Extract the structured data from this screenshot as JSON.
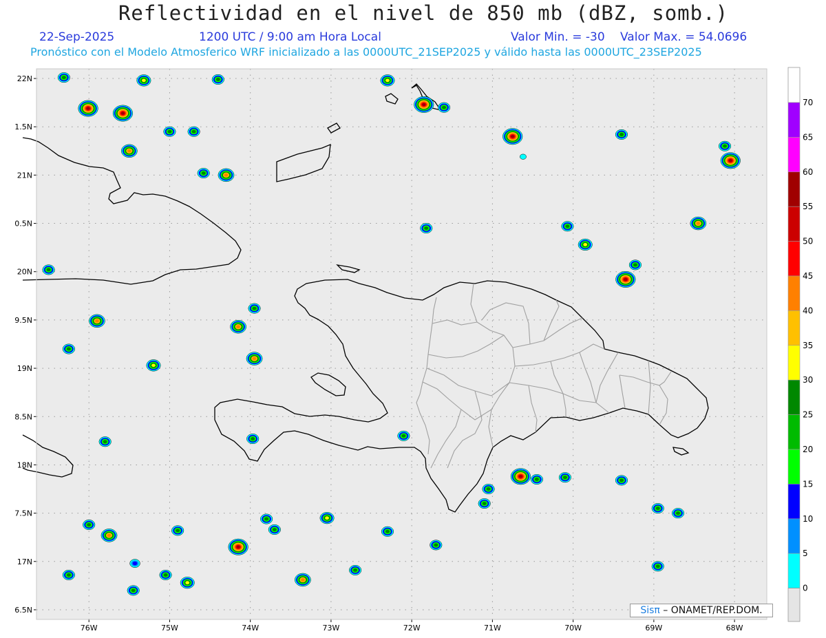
{
  "header": {
    "title": "Reflectividad en el nivel de 850 mb (dBZ, somb.)",
    "date": "22-Sep-2025",
    "time": "1200 UTC / 9:00 am Hora Local",
    "min_label": "Valor Min. = -30",
    "max_label": "Valor Max. = 54.0696",
    "forecast_line": "Pronóstico con el Modelo Atmosferico WRF inicializado a las 0000UTC_21SEP2025 y válido hasta las  0000UTC_23SEP2025"
  },
  "map": {
    "background_color": "#ebebeb",
    "lon_ticks": [
      "76W",
      "75W",
      "74W",
      "73W",
      "72W",
      "71W",
      "70W",
      "69W",
      "68W"
    ],
    "lat_ticks": [
      "22N",
      "1.5N",
      "21N",
      "0.5N",
      "20N",
      "9.5N",
      "19N",
      "8.5N",
      "18N",
      "7.5N",
      "17N",
      "6.5N"
    ]
  },
  "colorbar": {
    "labels": [
      "70",
      "65",
      "60",
      "55",
      "50",
      "45",
      "40",
      "35",
      "30",
      "25",
      "20",
      "15",
      "10",
      "5",
      "0"
    ],
    "colors": [
      "#a000ff",
      "#ff00ff",
      "#a00000",
      "#cc0000",
      "#ff0000",
      "#ff8000",
      "#ffc000",
      "#ffff00",
      "#008800",
      "#00bb00",
      "#00ff00",
      "#0000ff",
      "#0090ff",
      "#00ffff"
    ],
    "bottom_color": "#e5e5e5",
    "top_color": "#ffffff"
  },
  "credit": {
    "brand": "Sisπ",
    "org": " – ONAMET/REP.DOM."
  },
  "echoes": [
    {
      "lon": -76.01,
      "lat": 21.69,
      "peak": "red"
    },
    {
      "lon": -75.58,
      "lat": 21.64,
      "peak": "red"
    },
    {
      "lon": -75.5,
      "lat": 21.25,
      "peak": "orange"
    },
    {
      "lon": -75.32,
      "lat": 21.98,
      "peak": "yellow"
    },
    {
      "lon": -76.31,
      "lat": 22.01,
      "peak": "green"
    },
    {
      "lon": -75.0,
      "lat": 21.45,
      "peak": "green"
    },
    {
      "lon": -74.7,
      "lat": 21.45,
      "peak": "green"
    },
    {
      "lon": -74.58,
      "lat": 21.02,
      "peak": "green"
    },
    {
      "lon": -74.3,
      "lat": 21.0,
      "peak": "orange"
    },
    {
      "lon": -74.4,
      "lat": 21.99,
      "peak": "green"
    },
    {
      "lon": -71.85,
      "lat": 21.73,
      "peak": "red"
    },
    {
      "lon": -72.3,
      "lat": 21.98,
      "peak": "yellow"
    },
    {
      "lon": -71.6,
      "lat": 21.7,
      "peak": "green"
    },
    {
      "lon": -70.75,
      "lat": 21.4,
      "peak": "red"
    },
    {
      "lon": -70.62,
      "lat": 21.19,
      "peak": "cyan"
    },
    {
      "lon": -69.4,
      "lat": 21.42,
      "peak": "green"
    },
    {
      "lon": -68.05,
      "lat": 21.15,
      "peak": "red"
    },
    {
      "lon": -68.12,
      "lat": 21.3,
      "peak": "green"
    },
    {
      "lon": -71.82,
      "lat": 20.45,
      "peak": "green"
    },
    {
      "lon": -70.07,
      "lat": 20.47,
      "peak": "green"
    },
    {
      "lon": -69.85,
      "lat": 20.28,
      "peak": "yellow"
    },
    {
      "lon": -68.45,
      "lat": 20.5,
      "peak": "orange"
    },
    {
      "lon": -69.35,
      "lat": 19.92,
      "peak": "red"
    },
    {
      "lon": -69.23,
      "lat": 20.07,
      "peak": "green"
    },
    {
      "lon": -75.9,
      "lat": 19.49,
      "peak": "orange"
    },
    {
      "lon": -74.15,
      "lat": 19.43,
      "peak": "orange"
    },
    {
      "lon": -73.95,
      "lat": 19.62,
      "peak": "green"
    },
    {
      "lon": -73.95,
      "lat": 19.1,
      "peak": "orange"
    },
    {
      "lon": -76.25,
      "lat": 19.2,
      "peak": "green"
    },
    {
      "lon": -75.2,
      "lat": 19.03,
      "peak": "yellow"
    },
    {
      "lon": -76.5,
      "lat": 20.02,
      "peak": "green"
    },
    {
      "lon": -72.1,
      "lat": 18.3,
      "peak": "green"
    },
    {
      "lon": -75.8,
      "lat": 18.24,
      "peak": "green"
    },
    {
      "lon": -73.97,
      "lat": 18.27,
      "peak": "green"
    },
    {
      "lon": -70.65,
      "lat": 17.88,
      "peak": "red"
    },
    {
      "lon": -70.45,
      "lat": 17.85,
      "peak": "green"
    },
    {
      "lon": -70.1,
      "lat": 17.87,
      "peak": "green"
    },
    {
      "lon": -69.4,
      "lat": 17.84,
      "peak": "green"
    },
    {
      "lon": -71.05,
      "lat": 17.75,
      "peak": "green"
    },
    {
      "lon": -68.95,
      "lat": 17.55,
      "peak": "green"
    },
    {
      "lon": -68.7,
      "lat": 17.5,
      "peak": "green"
    },
    {
      "lon": -74.15,
      "lat": 17.15,
      "peak": "red"
    },
    {
      "lon": -73.05,
      "lat": 17.45,
      "peak": "yellow"
    },
    {
      "lon": -73.8,
      "lat": 17.44,
      "peak": "green"
    },
    {
      "lon": -73.7,
      "lat": 17.33,
      "peak": "green"
    },
    {
      "lon": -75.75,
      "lat": 17.27,
      "peak": "orange"
    },
    {
      "lon": -74.78,
      "lat": 16.78,
      "peak": "yellow"
    },
    {
      "lon": -73.35,
      "lat": 16.81,
      "peak": "orange"
    },
    {
      "lon": -72.7,
      "lat": 16.91,
      "peak": "green"
    },
    {
      "lon": -72.3,
      "lat": 17.31,
      "peak": "green"
    },
    {
      "lon": -71.7,
      "lat": 17.17,
      "peak": "green"
    },
    {
      "lon": -76.0,
      "lat": 17.38,
      "peak": "green"
    },
    {
      "lon": -76.25,
      "lat": 16.86,
      "peak": "green"
    },
    {
      "lon": -75.05,
      "lat": 16.86,
      "peak": "green"
    },
    {
      "lon": -74.9,
      "lat": 17.32,
      "peak": "green"
    },
    {
      "lon": -75.43,
      "lat": 16.98,
      "peak": "blue"
    },
    {
      "lon": -75.45,
      "lat": 16.7,
      "peak": "green"
    },
    {
      "lon": -68.95,
      "lat": 16.95,
      "peak": "green"
    },
    {
      "lon": -71.1,
      "lat": 17.6,
      "peak": "green"
    }
  ]
}
